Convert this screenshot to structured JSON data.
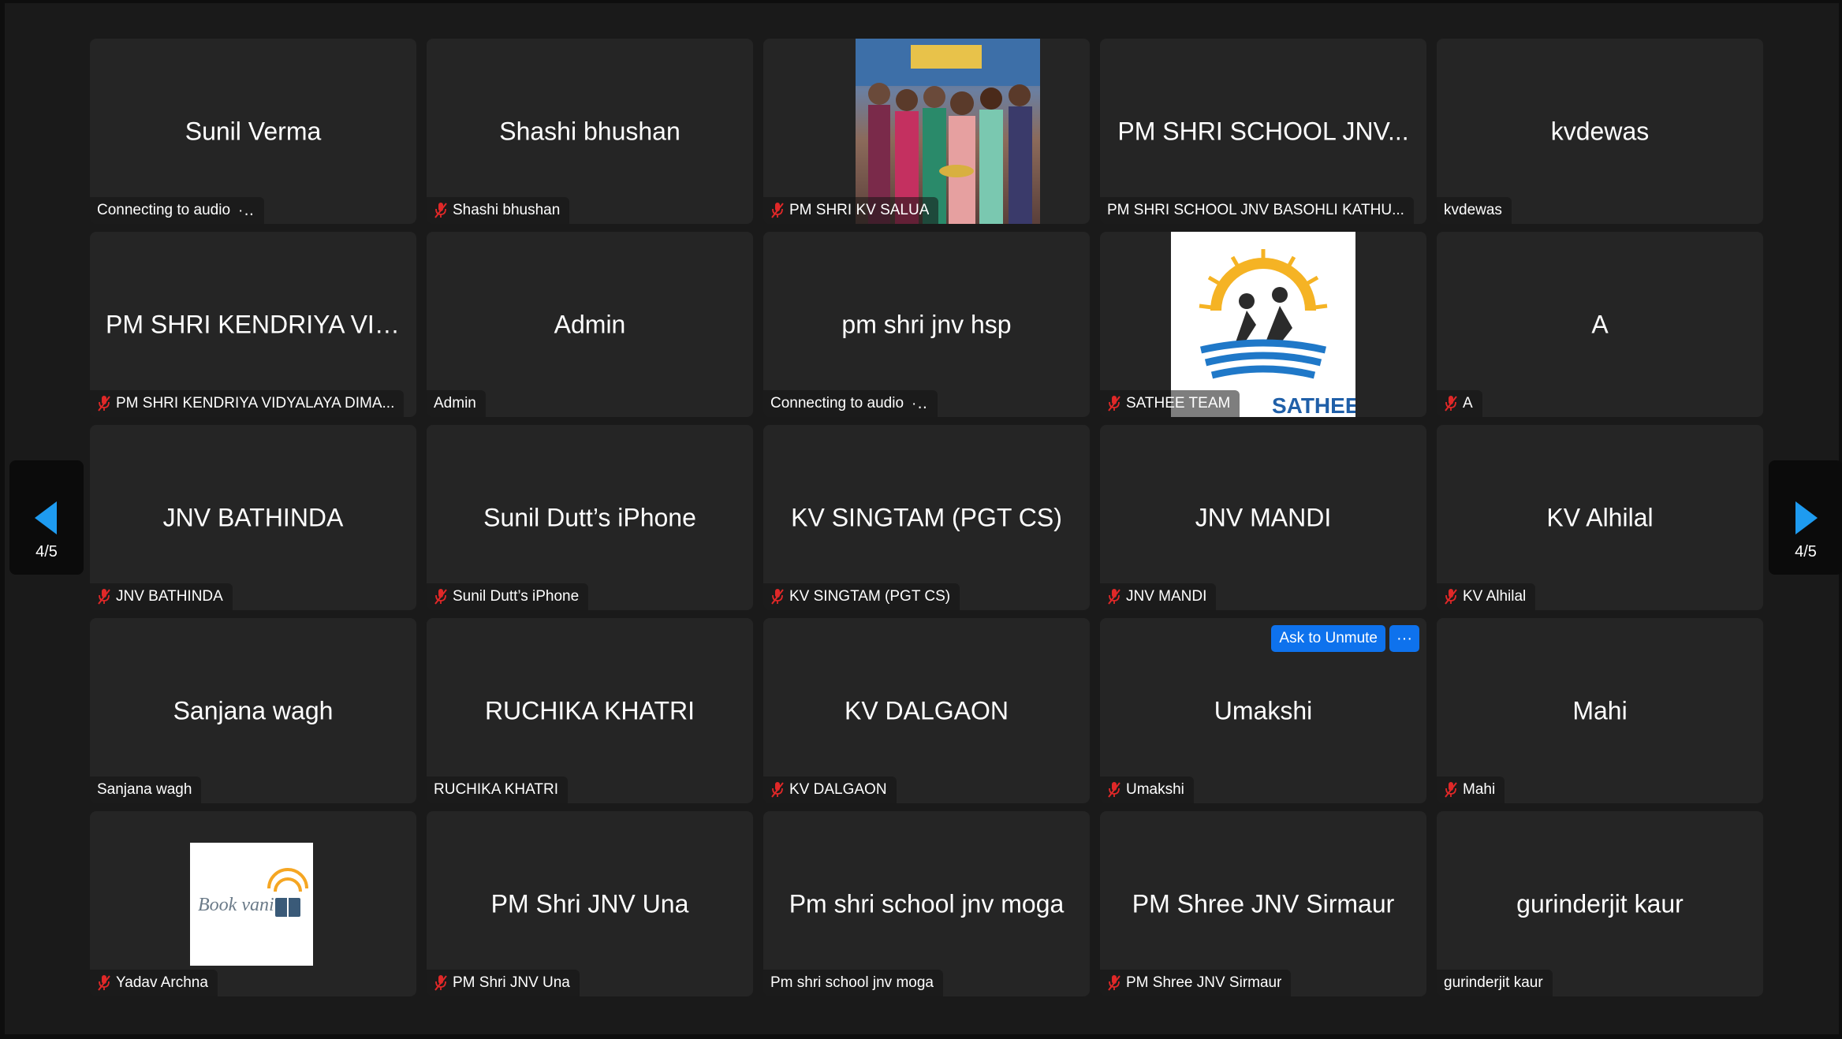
{
  "pagination": {
    "left_count": "4/5",
    "right_count": "4/5"
  },
  "colors": {
    "tile_bg": "#252525",
    "accent_blue": "#0e72ed",
    "mute_red": "#e02828"
  },
  "umakshi_controls": {
    "ask_unmute_label": "Ask to Unmute",
    "more_label": "···"
  },
  "tiles": [
    {
      "name": "Sunil Verma",
      "label": "Connecting to audio",
      "muted": false,
      "status": "connecting"
    },
    {
      "name": "Shashi bhushan",
      "label": "Shashi bhushan",
      "muted": true
    },
    {
      "name": "",
      "label": "PM SHRI KV SALUA",
      "muted": true,
      "photo": "group-photo"
    },
    {
      "name": "PM SHRI SCHOOL JNV...",
      "label": "PM SHRI SCHOOL JNV BASOHLI KATHU...",
      "muted": false
    },
    {
      "name": "kvdewas",
      "label": "kvdewas",
      "muted": false
    },
    {
      "name": "PM SHRI KENDRIYA VID...",
      "label": "PM SHRI KENDRIYA VIDYALAYA DIMA...",
      "muted": true
    },
    {
      "name": "Admin",
      "label": "Admin",
      "muted": false
    },
    {
      "name": "pm shri jnv hsp",
      "label": "Connecting to audio",
      "muted": false,
      "status": "connecting"
    },
    {
      "name": "",
      "label": "SATHEE TEAM",
      "muted": true,
      "photo": "sathee-logo",
      "logo_text": "SATHEE"
    },
    {
      "name": "A",
      "label": "A",
      "muted": true
    },
    {
      "name": "JNV BATHINDA",
      "label": "JNV BATHINDA",
      "muted": true
    },
    {
      "name": "Sunil Dutt’s iPhone",
      "label": "Sunil Dutt’s iPhone",
      "muted": true
    },
    {
      "name": "KV SINGTAM (PGT CS)",
      "label": "KV SINGTAM (PGT CS)",
      "muted": true
    },
    {
      "name": "JNV MANDI",
      "label": "JNV MANDI",
      "muted": true
    },
    {
      "name": "KV Alhilal",
      "label": "KV Alhilal",
      "muted": true
    },
    {
      "name": "Sanjana wagh",
      "label": "Sanjana wagh",
      "muted": false
    },
    {
      "name": "RUCHIKA KHATRI",
      "label": "RUCHIKA KHATRI",
      "muted": false
    },
    {
      "name": "KV DALGAON",
      "label": "KV DALGAON",
      "muted": true
    },
    {
      "name": "Umakshi",
      "label": "Umakshi",
      "muted": true,
      "hover_controls": true
    },
    {
      "name": "Mahi",
      "label": "Mahi",
      "muted": true
    },
    {
      "name": "",
      "label": "Yadav Archna",
      "muted": true,
      "photo": "bookvani-logo",
      "logo_text": "Book vani"
    },
    {
      "name": "PM Shri JNV Una",
      "label": "PM Shri JNV Una",
      "muted": true
    },
    {
      "name": "Pm shri school jnv moga",
      "label": "Pm shri school jnv moga",
      "muted": false
    },
    {
      "name": "PM Shree JNV Sirmaur",
      "label": "PM Shree JNV Sirmaur",
      "muted": true
    },
    {
      "name": "gurinderjit kaur",
      "label": "gurinderjit kaur",
      "muted": false
    }
  ]
}
